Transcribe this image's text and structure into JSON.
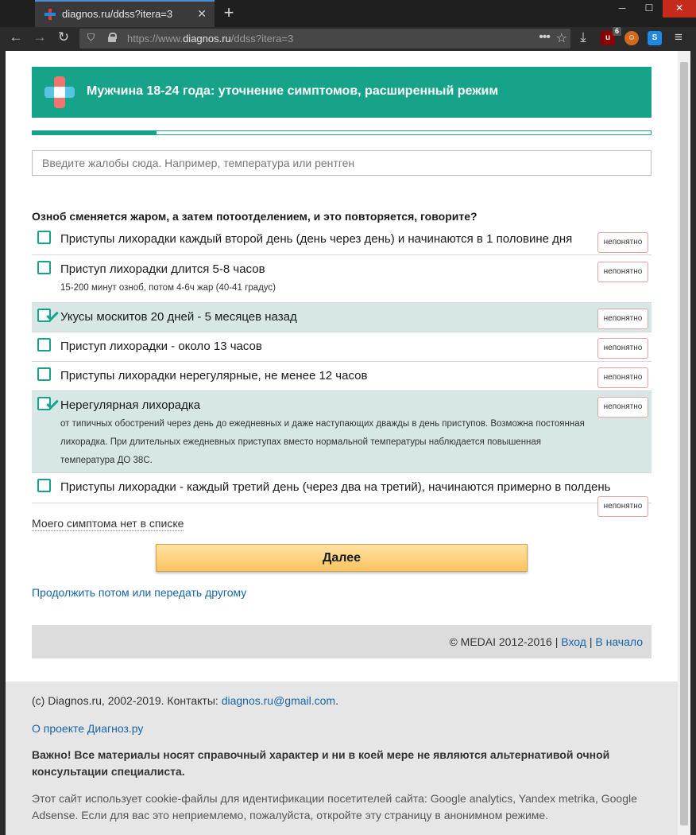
{
  "browser": {
    "tab_title": "diagnos.ru/ddss?itera=3",
    "url_prefix": "https://www.",
    "url_domain": "diagnos.ru",
    "url_path": "/ddss?itera=3",
    "ext_badge": "6",
    "ext_label": "u"
  },
  "header": {
    "title": "Мужчина 18-24 года: уточнение симптомов, расширенный режим"
  },
  "progress_fraction": 0.2,
  "search": {
    "placeholder": "Введите жалобы сюда. Например, температура или рентген"
  },
  "question": "Озноб сменяется жаром, а затем потоотделением, и это повторяется, говорите?",
  "options": [
    {
      "label": "Приступы лихорадки каждый второй день (день через день) и начинаются в 1 половине дня",
      "desc": "",
      "checked": false,
      "unclear": "непонятно"
    },
    {
      "label": "Приступ лихорадки длится 5-8 часов",
      "desc": "15-200 минут озноб, потом 4-6ч жар (40-41 градус)",
      "checked": false,
      "unclear": "непонятно"
    },
    {
      "label": "Укусы москитов 20 дней - 5 месяцев назад",
      "desc": "",
      "checked": true,
      "unclear": "непонятно"
    },
    {
      "label": "Приступ лихорадки - около 13 часов",
      "desc": "",
      "checked": false,
      "unclear": "непонятно"
    },
    {
      "label": "Приступы лихорадки нерегулярные, не менее 12 часов",
      "desc": "",
      "checked": false,
      "unclear": "непонятно"
    },
    {
      "label": "Нерегулярная лихорадка",
      "desc": "от типичных обострений через день до ежедневных и даже наступающих дважды в день приступов. Возможна постоянная лихорадка. При длительных ежедневных приступах вместо нормальной температуры наблюдается повышенная температура ДО 38С.",
      "checked": true,
      "unclear": "непонятно"
    },
    {
      "label": "Приступы лихорадки - каждый третий день (через два на третий), начинаются примерно в полдень",
      "desc": "",
      "checked": false,
      "unclear": "непонятно"
    }
  ],
  "no_symptom": "Моего симптома нет в списке",
  "next_button": "Далее",
  "continue_link": "Продолжить потом или передать другому",
  "copyright": {
    "text": "© MEDAI 2012-2016",
    "sep": "|",
    "login": "Вход",
    "start": "В начало"
  },
  "footer": {
    "line1_prefix": "(с) Diagnos.ru, 2002-2019. Контакты: ",
    "email": "diagnos.ru@gmail.com",
    "line1_suffix": ".",
    "about": "О проекте Диагноз.ру",
    "important": "Важно! Все материалы носят справочный характер и ни в коей мере не являются альтернативой очной консультации специалиста.",
    "cookies": "Этот сайт использует cookie-файлы для идентификации посетителей сайта: Google analytics, Yandex metrika, Google Adsense. Если для вас это неприемлемо, пожалуйста, откройте эту страницу в анонимном режиме."
  },
  "colors": {
    "accent": "#17a389",
    "link": "#1565a8",
    "selected_row": "#d6e7e6",
    "button": "#f9c35f"
  }
}
